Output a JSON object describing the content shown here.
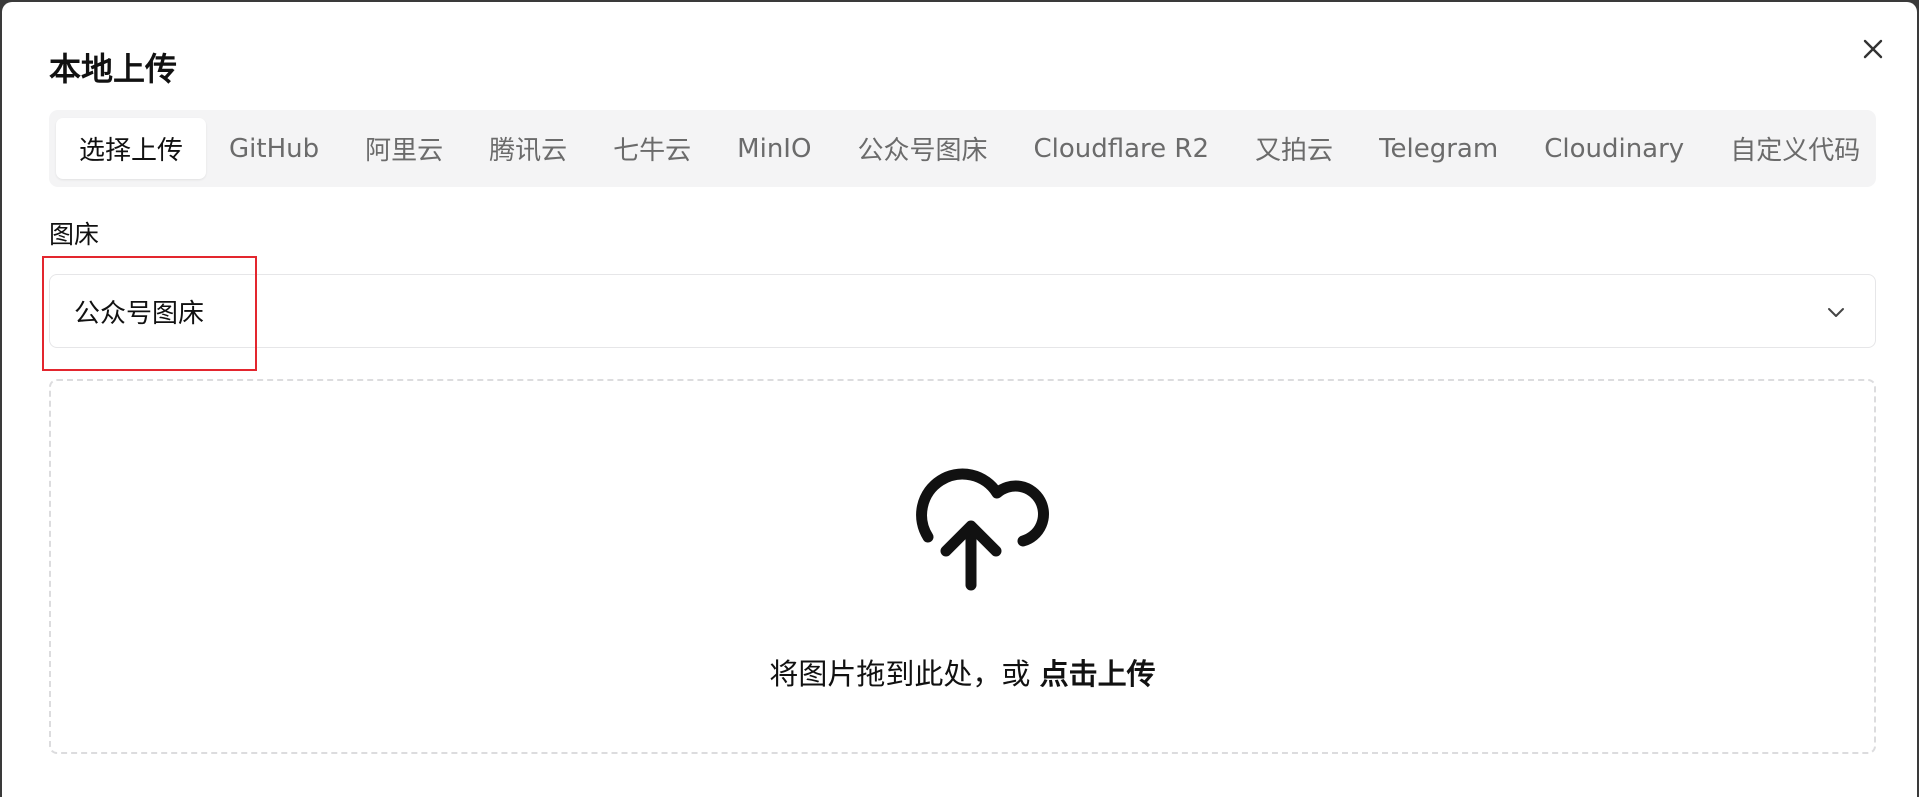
{
  "dialog": {
    "title": "本地上传",
    "close_icon": "close-icon"
  },
  "tabs": [
    {
      "label": "选择上传",
      "active": true
    },
    {
      "label": "GitHub",
      "active": false
    },
    {
      "label": "阿里云",
      "active": false
    },
    {
      "label": "腾讯云",
      "active": false
    },
    {
      "label": "七牛云",
      "active": false
    },
    {
      "label": "MinIO",
      "active": false
    },
    {
      "label": "公众号图床",
      "active": false
    },
    {
      "label": "Cloudflare R2",
      "active": false
    },
    {
      "label": "又拍云",
      "active": false
    },
    {
      "label": "Telegram",
      "active": false
    },
    {
      "label": "Cloudinary",
      "active": false
    },
    {
      "label": "自定义代码",
      "active": false
    }
  ],
  "image_host": {
    "label": "图床",
    "selected": "公众号图床",
    "chevron_icon": "chevron-down-icon"
  },
  "dropzone": {
    "icon": "cloud-upload-icon",
    "text": "将图片拖到此处，或 ",
    "link": "点击上传"
  },
  "colors": {
    "highlight": "#e3262e",
    "tabs_background": "#f4f4f5",
    "active_tab_background": "#ffffff"
  }
}
